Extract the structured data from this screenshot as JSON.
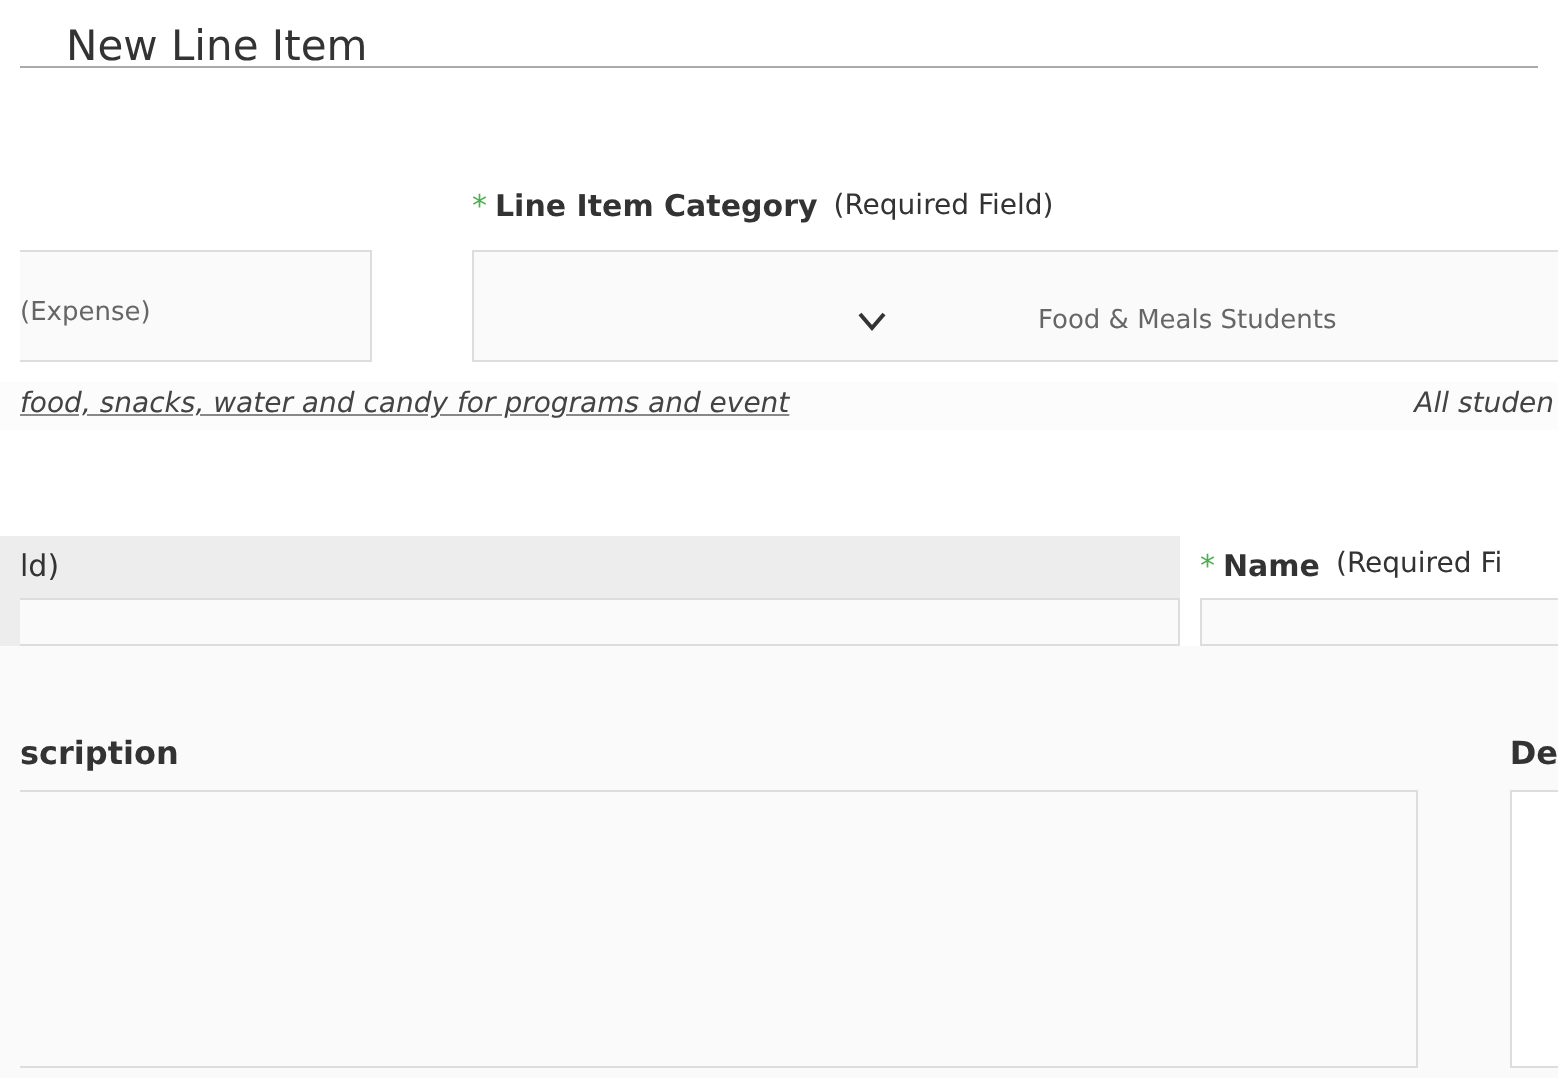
{
  "title": "New Line Item",
  "category": {
    "label": "Line Item Category",
    "required_mark": "*",
    "hint": "(Required Field)",
    "left_value": "(Expense)",
    "value": "Food & Meals Students",
    "help": "food, snacks, water and candy for programs and event",
    "help_right": "All studen"
  },
  "field_a": {
    "label": "ld)"
  },
  "name": {
    "label": "Name",
    "required_mark": "*",
    "hint": "(Required Fi"
  },
  "description": {
    "label": "scription"
  },
  "field_d": {
    "label": "De"
  }
}
